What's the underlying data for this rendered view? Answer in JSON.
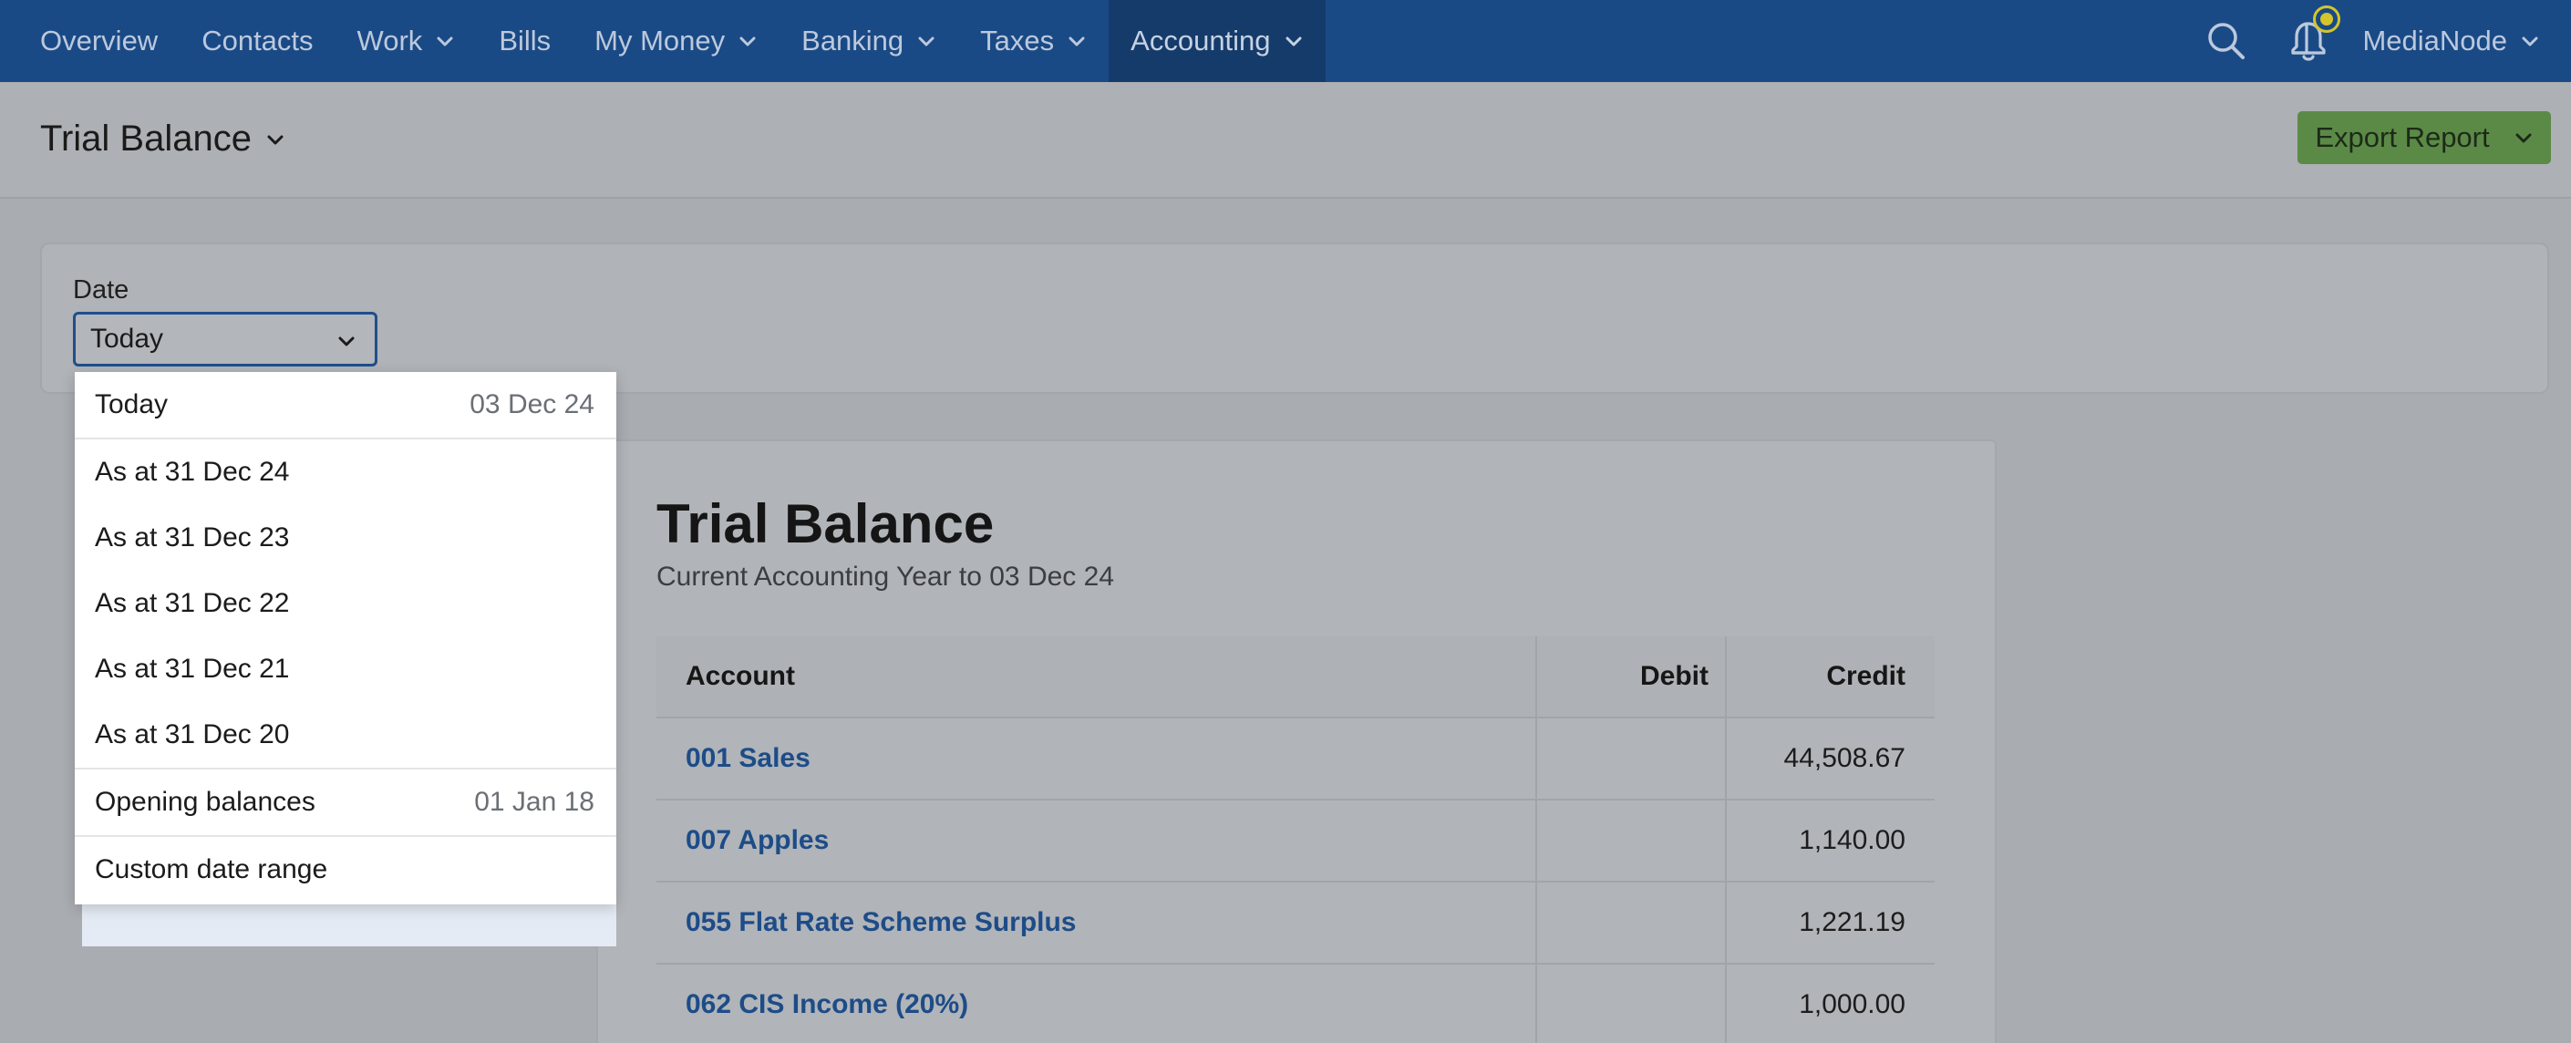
{
  "nav": {
    "items": [
      {
        "label": "Overview",
        "has_menu": false
      },
      {
        "label": "Contacts",
        "has_menu": false
      },
      {
        "label": "Work",
        "has_menu": true
      },
      {
        "label": "Bills",
        "has_menu": false
      },
      {
        "label": "My Money",
        "has_menu": true
      },
      {
        "label": "Banking",
        "has_menu": true
      },
      {
        "label": "Taxes",
        "has_menu": true
      },
      {
        "label": "Accounting",
        "has_menu": true,
        "active": true
      }
    ],
    "user_name": "MediaNode",
    "notification_dot_color": "#d4c52c"
  },
  "header": {
    "title": "Trial Balance",
    "export_label": "Export Report"
  },
  "filter": {
    "date_label": "Date",
    "date_value": "Today"
  },
  "dropdown": {
    "options": [
      {
        "label": "Today",
        "meta": "03 Dec 24"
      },
      {
        "label": "As at 31 Dec 24",
        "meta": ""
      },
      {
        "label": "As at 31 Dec 23",
        "meta": ""
      },
      {
        "label": "As at 31 Dec 22",
        "meta": ""
      },
      {
        "label": "As at 31 Dec 21",
        "meta": ""
      },
      {
        "label": "As at 31 Dec 20",
        "meta": ""
      },
      {
        "label": "Opening balances",
        "meta": "01 Jan 18"
      },
      {
        "label": "Custom date range",
        "meta": ""
      }
    ]
  },
  "report": {
    "title": "Trial Balance",
    "subtitle": "Current Accounting Year to 03 Dec 24",
    "columns": {
      "account": "Account",
      "debit": "Debit",
      "credit": "Credit"
    },
    "rows": [
      {
        "account": "001 Sales",
        "debit": "",
        "credit": "44,508.67"
      },
      {
        "account": "007 Apples",
        "debit": "",
        "credit": "1,140.00"
      },
      {
        "account": "055 Flat Rate Scheme Surplus",
        "debit": "",
        "credit": "1,221.19"
      },
      {
        "account": "062 CIS Income (20%)",
        "debit": "",
        "credit": "1,000.00"
      }
    ]
  },
  "colors": {
    "nav_bg": "#1a4a86",
    "accent_link": "#1d4c88",
    "export_bg": "#5b8a47"
  }
}
